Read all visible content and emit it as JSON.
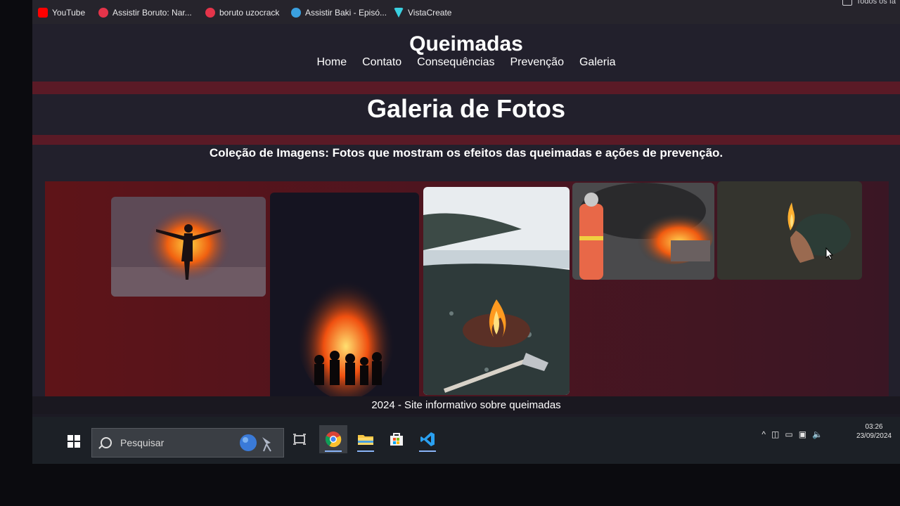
{
  "bookmarks": [
    {
      "label": "YouTube",
      "icon": "youtube-icon",
      "color": "#ff0000"
    },
    {
      "label": "Assistir Boruto: Nar...",
      "icon": "anime-site-icon",
      "color": "#e4344a"
    },
    {
      "label": "boruto uzocrack",
      "icon": "anime-site-icon",
      "color": "#e4344a"
    },
    {
      "label": "Assistir Baki - Episó...",
      "icon": "site-icon",
      "color": "#3aa0e0"
    },
    {
      "label": "VistaCreate",
      "icon": "vistacreate-icon",
      "color": "#3ad0e0"
    }
  ],
  "bookmarks_folder": "Todos os fa",
  "site": {
    "title": "Queimadas",
    "nav": [
      "Home",
      "Contato",
      "Consequências",
      "Prevenção",
      "Galeria"
    ],
    "gallery_title": "Galeria de Fotos",
    "subtitle": "Coleção de Imagens: Fotos que mostram os efeitos das queimadas e ações de prevenção.",
    "photos": [
      "person-silhouette-fire-photo",
      "group-bonfire-photo",
      "campfire-lake-axe-photo",
      "firefighter-smoke-photo",
      "hand-flame-photo"
    ],
    "footer": "2024 - Site informativo sobre queimadas"
  },
  "taskbar": {
    "search_placeholder": "Pesquisar",
    "apps": [
      "task-view-icon",
      "chrome-icon",
      "file-explorer-icon",
      "microsoft-store-icon",
      "vscode-icon"
    ],
    "time": "03:26",
    "date": "23/09/2024"
  },
  "colors": {
    "band": "#5a1a26",
    "gallery_bg": "#5e1418",
    "accent": "#8ab4f8"
  }
}
